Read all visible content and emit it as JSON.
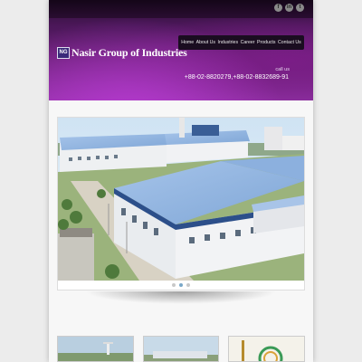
{
  "header": {
    "company_name": "Nasir Group of Industries",
    "logo_mark": "NG",
    "call_us_label": "call us",
    "phone_numbers": "+88-02-8820279,+88-02-8832689-91"
  },
  "social": [
    {
      "icon": "facebook-icon",
      "glyph": "f"
    },
    {
      "icon": "linkedin-icon",
      "glyph": "in"
    },
    {
      "icon": "twitter-icon",
      "glyph": "t"
    }
  ],
  "nav": {
    "items": [
      "Home",
      "About Us",
      "Industries",
      "Career",
      "Products",
      "Contact Us"
    ]
  },
  "slider": {
    "active_index": 1,
    "count": 3
  },
  "colors": {
    "header_dark": "#2b0f33",
    "header_accent": "#8d2fa0",
    "nav_bg": "#1a0d20",
    "roof_blue": "#8fb3e0"
  }
}
